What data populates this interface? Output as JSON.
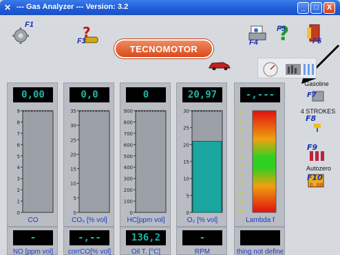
{
  "window": {
    "title": "--- Gas Analyzer --- Version:  3.2",
    "minimize": "_",
    "maximize": "□",
    "close": "X"
  },
  "toolbar": {
    "f1": "F1",
    "f3": "F3",
    "f4": "F4",
    "f5": "F5",
    "f6": "F6",
    "brand": "TECNOMOTOR"
  },
  "panels": [
    {
      "name": "co",
      "value": "0,00",
      "label": "CO",
      "ticks": [
        "9",
        "8",
        "7",
        "6",
        "5",
        "4",
        "3",
        "2",
        "1",
        "0"
      ],
      "fill": 0
    },
    {
      "name": "co2",
      "value": "0,0",
      "label": "CO₂ [% vol]",
      "ticks": [
        "35",
        "30",
        "25",
        "20",
        "15",
        "10",
        "5",
        "0"
      ],
      "fill": 0
    },
    {
      "name": "hc",
      "value": "0",
      "label": "HC[ppm vol]",
      "ticks": [
        "900",
        "800",
        "700",
        "600",
        "500",
        "400",
        "300",
        "200",
        "100",
        "0"
      ],
      "fill": 0
    },
    {
      "name": "o2",
      "value": "20,97",
      "label": "O₂ [% vol]",
      "ticks": [
        "30",
        "25",
        "20",
        "15",
        "10",
        "5",
        "0"
      ],
      "fill": 0.699
    },
    {
      "name": "lambda",
      "value": "-,---",
      "label": "Lambda f",
      "ticks": [
        "1.20",
        "1.10",
        "1.05",
        "1.03",
        "1.01",
        "1.00",
        "0.99",
        "0.98",
        "0.97",
        "0.95",
        "0.90",
        "0.80"
      ]
    }
  ],
  "bottom_panels": [
    {
      "name": "no",
      "value": "-",
      "label": "NO [ppm vol]"
    },
    {
      "name": "corrco",
      "value": "-,--",
      "label": "corrCO[% vol]"
    },
    {
      "name": "oil-temp",
      "value": "136,2",
      "label": "Oil T. [°C]"
    },
    {
      "name": "rpm",
      "value": "-",
      "label": "RPM"
    },
    {
      "name": "not-defined",
      "value": "",
      "label": "thing not define"
    }
  ],
  "side": {
    "gasoline": "Gasoline",
    "f7": "F7",
    "strokes": "4 STROKES",
    "f8": "F8",
    "f9": "F9",
    "autozero": "Autozero",
    "f10": "F10"
  },
  "colors": {
    "digit": "#1db5a8",
    "o2_fill": "#1aa6a0",
    "label": "#1a3ad0"
  }
}
